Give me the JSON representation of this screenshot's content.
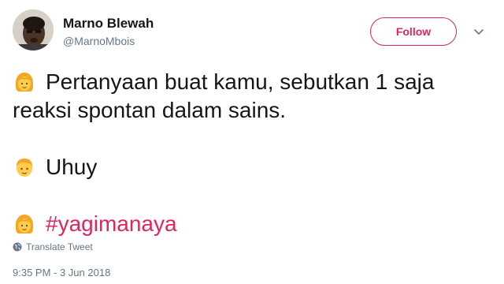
{
  "user": {
    "display_name": "Marno Blewah",
    "handle": "@MarnoMbois"
  },
  "follow_button": {
    "label": "Follow",
    "accent_color": "#e0245e"
  },
  "menu_icon": "chevron-down-icon",
  "tweet": {
    "line1": "Pertanyaan buat kamu, sebutkan 1 saja",
    "line2": "reaksi spontan dalam sains.",
    "line3": "Uhuy",
    "hashtag": "#yagimanaya",
    "emojis": [
      "woman-emoji",
      "man-emoji",
      "woman-emoji"
    ]
  },
  "translate_label": "Translate Tweet",
  "timestamp": "9:35 PM - 3 Jun 2018"
}
